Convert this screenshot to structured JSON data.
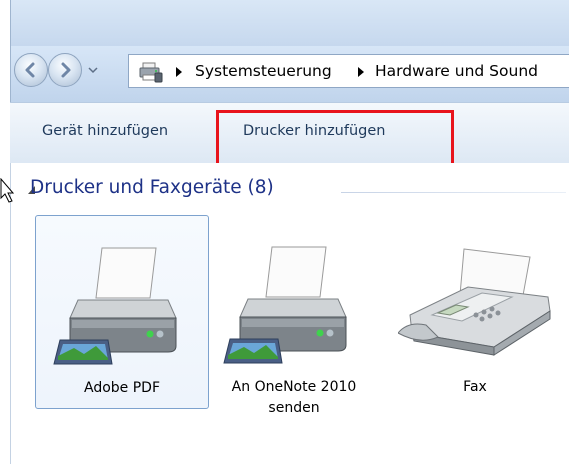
{
  "navigation": {
    "back_icon": "back-arrow-icon",
    "forward_icon": "forward-arrow-icon",
    "history_icon": "chevron-down-icon"
  },
  "address_bar": {
    "location_icon": "devices-and-printers-icon",
    "breadcrumbs": [
      "Systemsteuerung",
      "Hardware und Sound"
    ]
  },
  "command_bar": {
    "add_device_label": "Gerät hinzufügen",
    "add_printer_label": "Drucker hinzufügen",
    "highlight_color": "#e8141c"
  },
  "group": {
    "title": "Drucker und Faxgeräte (8)",
    "title_color": "#1e3287"
  },
  "devices": [
    {
      "label": "Adobe PDF",
      "icon": "printer-icon",
      "selected": true
    },
    {
      "label": "An OneNote 2010 senden",
      "icon": "printer-icon",
      "selected": false
    },
    {
      "label": "Fax",
      "icon": "fax-machine-icon",
      "selected": false
    }
  ]
}
